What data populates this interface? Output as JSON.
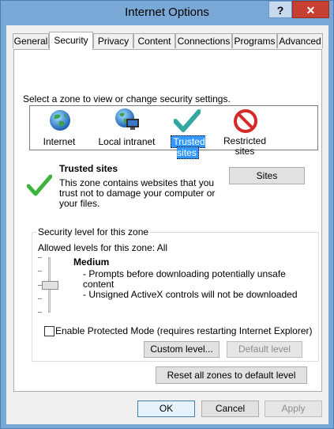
{
  "window": {
    "title": "Internet Options",
    "help_label": "?",
    "close_label": "✕"
  },
  "tabs": [
    "General",
    "Security",
    "Privacy",
    "Content",
    "Connections",
    "Programs",
    "Advanced"
  ],
  "security": {
    "zone_prompt": "Select a zone to view or change security settings.",
    "zones": [
      {
        "label": "Internet",
        "icon": "globe-icon"
      },
      {
        "label": "Local intranet",
        "icon": "intranet-icon"
      },
      {
        "label": "Trusted sites",
        "icon": "trusted-check-icon",
        "selected": true
      },
      {
        "label": "Restricted sites",
        "label_line1": "Restricted",
        "label_line2": "sites",
        "icon": "restricted-icon"
      }
    ],
    "zone_info": {
      "title": "Trusted sites",
      "line1": "This zone contains websites that you",
      "line2": "trust not to damage your computer or",
      "line3": "your files."
    },
    "sites_button": "Sites",
    "level_group_title": "Security level for this zone",
    "allowed_levels": "Allowed levels for this zone: All",
    "level_name": "Medium",
    "level_desc": [
      "- Prompts before downloading potentially unsafe",
      "content",
      "- Unsigned ActiveX controls will not be downloaded"
    ],
    "slider_level": 0.5,
    "protected_mode_label": "Enable Protected Mode (requires restarting Internet Explorer)",
    "custom_level_button": "Custom level...",
    "default_level_button": "Default level",
    "reset_all_button": "Reset all zones to default level"
  },
  "footer": {
    "ok": "OK",
    "cancel": "Cancel",
    "apply": "Apply"
  },
  "colors": {
    "accent": "#3399ff",
    "titlebar": "#7aa8d6",
    "close": "#c84031"
  }
}
